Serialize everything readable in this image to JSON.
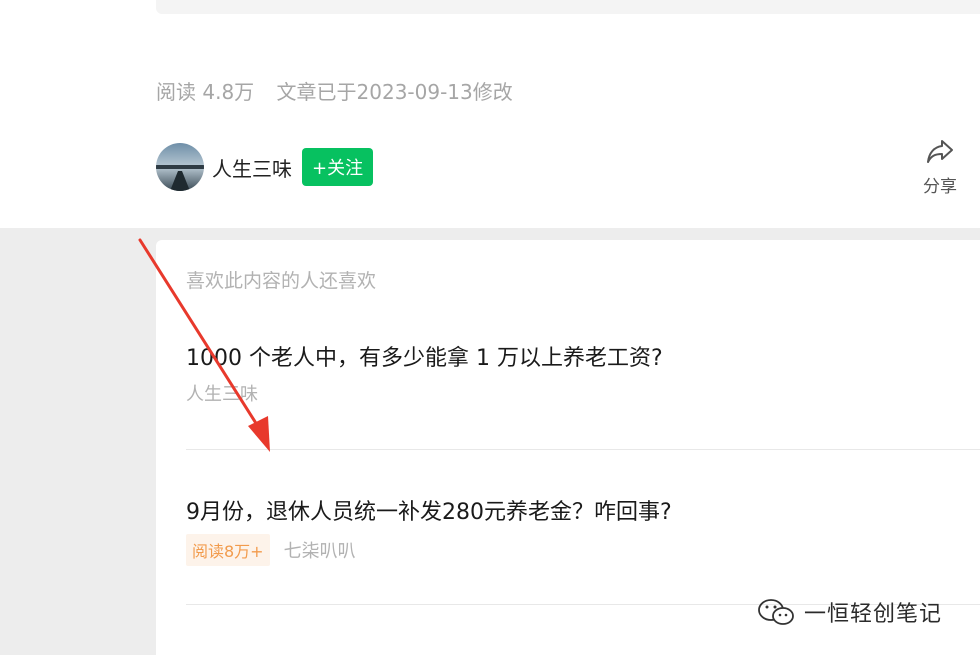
{
  "article": {
    "read_count": "阅读 4.8万",
    "modified": "文章已于2023-09-13修改"
  },
  "author": {
    "name": "人生三味",
    "follow_label": "+关注"
  },
  "share": {
    "label": "分享"
  },
  "recommend": {
    "heading": "喜欢此内容的人还喜欢",
    "items": [
      {
        "title": "1000 个老人中，有多少能拿 1 万以上养老工资?",
        "author": "人生三味",
        "badge": ""
      },
      {
        "title": "9月份，退休人员统一补发280元养老金？咋回事?",
        "author": "七柒叭叭",
        "badge": "阅读8万+"
      }
    ]
  },
  "watermark": {
    "text": "一恒轻创笔记",
    "icon": "wechat-icon"
  },
  "colors": {
    "follow": "#07c160",
    "arrow": "#e8392c",
    "badge_text": "#f29b4c"
  }
}
